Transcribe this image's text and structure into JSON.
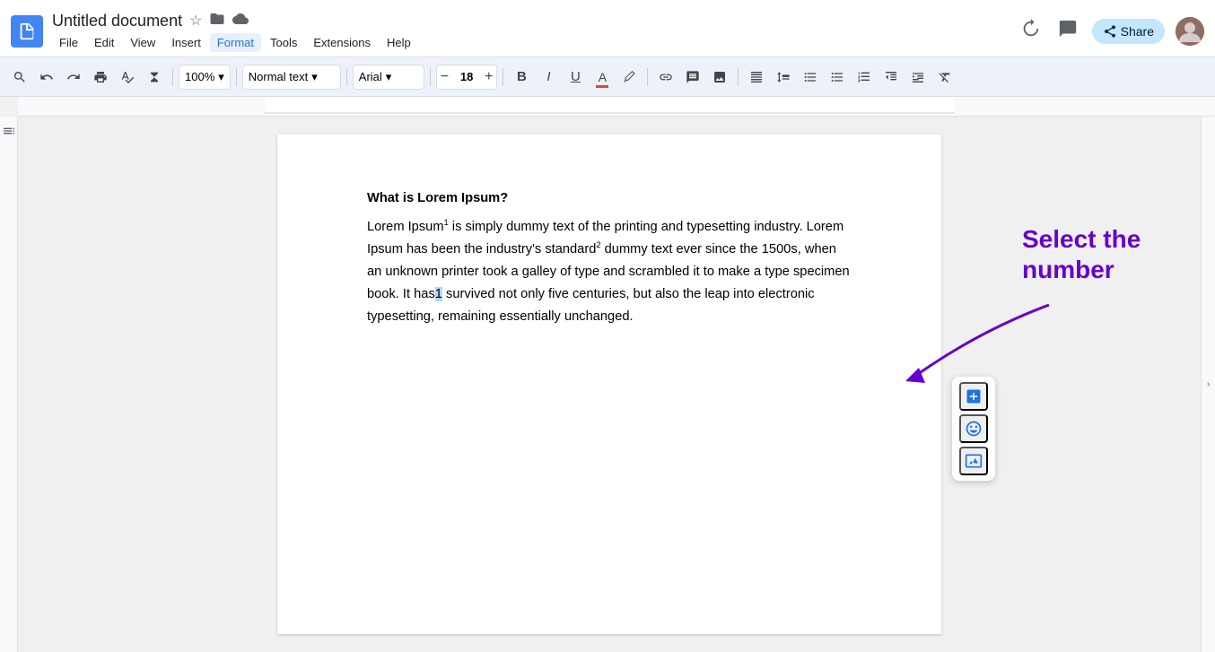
{
  "titlebar": {
    "doc_title": "Untitled document",
    "star_icon": "★",
    "folder_icon": "📁",
    "cloud_icon": "☁",
    "share_label": "Share",
    "history_label": "Version history",
    "comment_label": "Comments"
  },
  "menu": {
    "items": [
      "File",
      "Edit",
      "View",
      "Insert",
      "Format",
      "Tools",
      "Extensions",
      "Help"
    ]
  },
  "toolbar": {
    "zoom": "100%",
    "style": "Normal text",
    "font": "Arial",
    "font_size": "18",
    "bold": "B",
    "italic": "I",
    "underline": "U"
  },
  "document": {
    "heading": "What is Lorem Ipsum?",
    "paragraph": "Lorem Ipsum",
    "sup1": "1",
    "body1": " is simply dummy text of the printing and typesetting industry. Lorem Ipsum has been the industry's standard",
    "sup2": "2",
    "body2": " dummy text ever since the 1500s, when an unknown printer took a galley of type and scrambled it to make a type specimen book. It has",
    "selected": "1",
    "body3": " survived not only five centuries, but also the leap into electronic typesetting, remaining essentially unchanged."
  },
  "annotation": {
    "line1": "Select the",
    "line2": "number"
  },
  "floating_toolbar": {
    "add_icon": "⊞",
    "emoji_icon": "☺",
    "image_icon": "⊟"
  }
}
